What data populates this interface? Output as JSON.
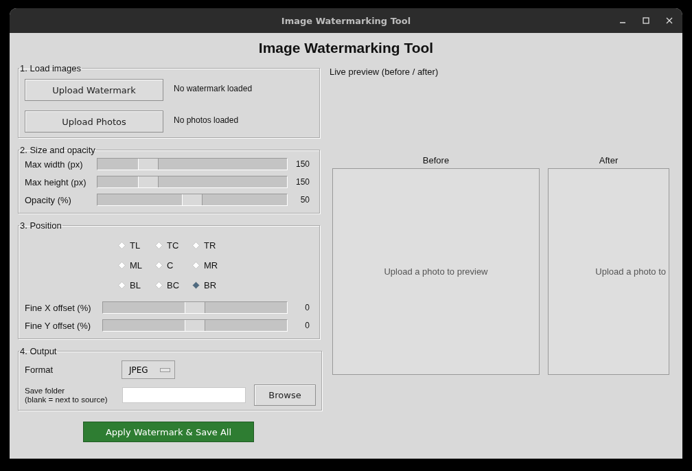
{
  "window": {
    "title": "Image Watermarking Tool"
  },
  "heading": "Image Watermarking Tool",
  "load_images": {
    "title": "1. Load images",
    "rows": [
      {
        "button": "Upload Watermark",
        "status": "No watermark loaded"
      },
      {
        "button": "Upload Photos",
        "status": "No photos loaded"
      }
    ]
  },
  "size_opacity": {
    "title": "2. Size and opacity",
    "sliders": [
      {
        "label": "Max width (px)",
        "level": 0.24,
        "reading": "150"
      },
      {
        "label": "Max height (px)",
        "level": 0.24,
        "reading": "150"
      },
      {
        "label": "Opacity (%)",
        "level": 0.5,
        "reading": "50"
      }
    ]
  },
  "position": {
    "title": "3. Position",
    "options": [
      {
        "label": "TL",
        "selected": false
      },
      {
        "label": "TC",
        "selected": false
      },
      {
        "label": "TR",
        "selected": false
      },
      {
        "label": "ML",
        "selected": false
      },
      {
        "label": "C",
        "selected": false
      },
      {
        "label": "MR",
        "selected": false
      },
      {
        "label": "BL",
        "selected": false
      },
      {
        "label": "BC",
        "selected": false
      },
      {
        "label": "BR",
        "selected": true
      }
    ],
    "sliders": [
      {
        "label": "Fine X offset (%)",
        "level": 0.5,
        "reading": "0"
      },
      {
        "label": "Fine Y offset (%)",
        "level": 0.5,
        "reading": "0"
      }
    ]
  },
  "output": {
    "title": "4. Output",
    "format_label": "Format",
    "format": "JPEG",
    "folder_label": "Save folder",
    "folder_hint": "(blank = next to source)",
    "browse": "Browse"
  },
  "apply_button": "Apply Watermark & Save All",
  "preview": {
    "title": "Live preview (before / after)",
    "panes": [
      {
        "label": "Before",
        "message": "Upload a photo to preview"
      },
      {
        "label": "After",
        "message": "Upload a photo to"
      }
    ]
  }
}
